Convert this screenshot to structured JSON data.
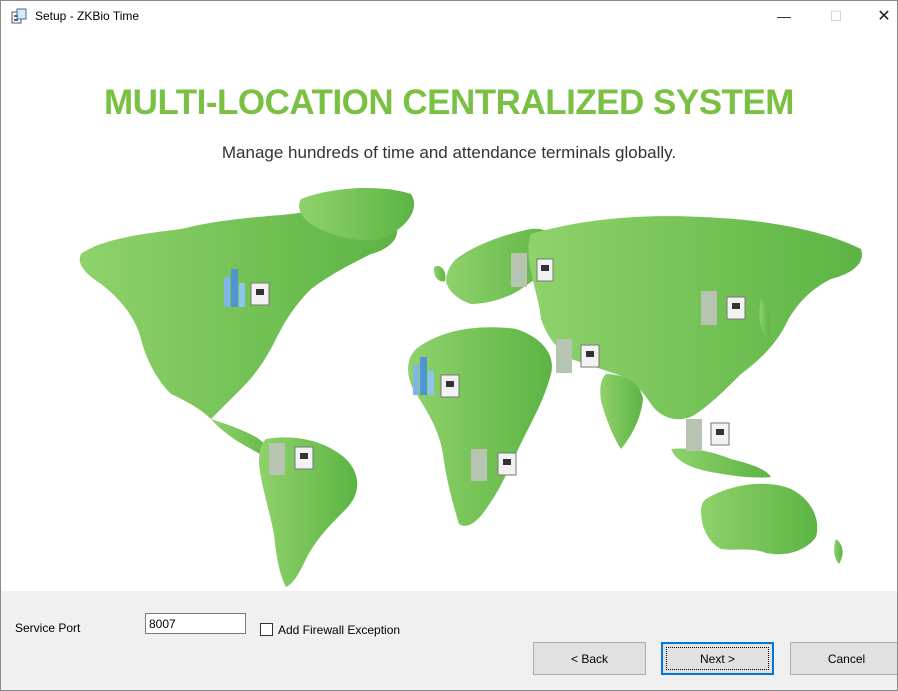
{
  "window": {
    "title": "Setup - ZKBio Time",
    "controls": {
      "minimize_glyph": "—",
      "maximize_glyph": "☐",
      "close_glyph": "✕"
    }
  },
  "hero": {
    "headline": "MULTI-LOCATION CENTRALIZED SYSTEM",
    "subline": "Manage hundreds of time and attendance terminals globally."
  },
  "colors": {
    "brand_green": "#7ac143",
    "map_green": "#6dbb4f",
    "focus_blue": "#0078d7"
  },
  "footer": {
    "service_port_label": "Service Port",
    "service_port_value": "8007",
    "firewall_label": "Add Firewall Exception",
    "firewall_checked": false
  },
  "buttons": {
    "back_label": "< Back",
    "next_label": "Next >",
    "cancel_label": "Cancel"
  }
}
